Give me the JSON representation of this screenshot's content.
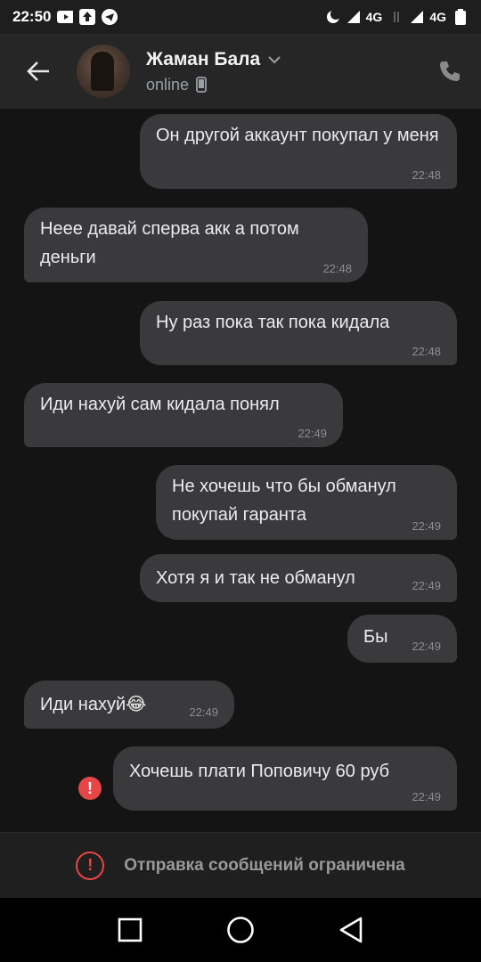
{
  "status_bar": {
    "time": "22:50",
    "network_1": "4G",
    "network_2": "4G",
    "icons": [
      "youtube-icon",
      "upload-icon",
      "telegram-icon",
      "moon-icon",
      "signal-icon",
      "battery-icon"
    ]
  },
  "header": {
    "name": "Жаман Бала",
    "status": "online",
    "icons": [
      "back-arrow-icon",
      "chevron-down-icon",
      "phone-device-icon",
      "call-icon"
    ]
  },
  "messages": [
    {
      "dir": "out",
      "text": "Он другой аккаунт покупал у меня",
      "time": "22:48"
    },
    {
      "dir": "in",
      "text": "Неее давай сперва акк а потом деньги",
      "time": "22:48"
    },
    {
      "dir": "out",
      "text": "Ну раз пока так пока кидала",
      "time": "22:48"
    },
    {
      "dir": "in",
      "text": "Иди нахуй сам кидала понял",
      "time": "22:49"
    },
    {
      "dir": "out",
      "text": "Не хочешь что бы обманул покупай гаранта",
      "time": "22:49"
    },
    {
      "dir": "out",
      "text": "Хотя я и так не обманул",
      "time": "22:49"
    },
    {
      "dir": "out",
      "text": "Бы",
      "time": "22:49"
    },
    {
      "dir": "in",
      "text": "Иди нахуй😂",
      "time": "22:49"
    },
    {
      "dir": "out",
      "text": "Хочешь плати Поповичу 60 руб",
      "time": "22:49",
      "failed": true
    }
  ],
  "footer": {
    "restricted_text": "Отправка сообщений ограничена"
  },
  "colors": {
    "bubble": "#3a3a3c",
    "error": "#e64646",
    "header": "#262626"
  }
}
